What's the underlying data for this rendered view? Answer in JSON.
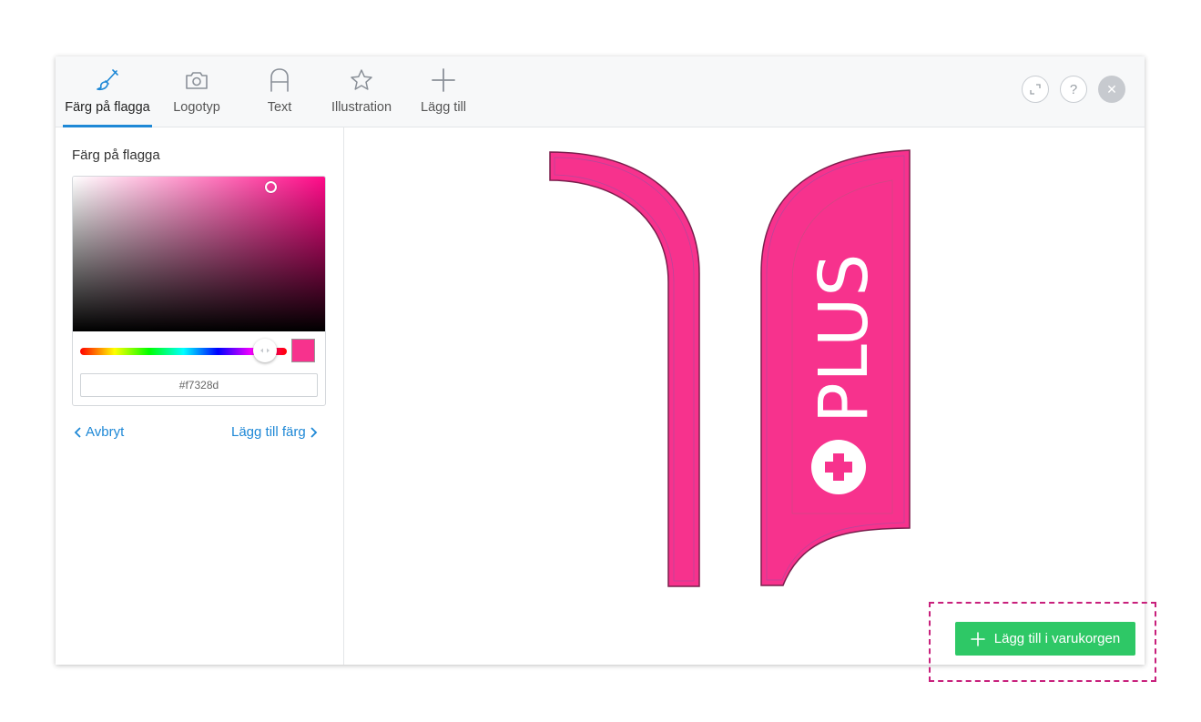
{
  "toolbar": {
    "tabs": [
      {
        "label": "Färg på flagga",
        "icon": "brush-icon",
        "active": true
      },
      {
        "label": "Logotyp",
        "icon": "camera-icon",
        "active": false
      },
      {
        "label": "Text",
        "icon": "letter-a-icon",
        "active": false
      },
      {
        "label": "Illustration",
        "icon": "star-icon",
        "active": false
      },
      {
        "label": "Lägg till",
        "icon": "plus-icon",
        "active": false
      }
    ],
    "tools": {
      "expand_icon": "expand-icon",
      "help_label": "?",
      "close_label": "✕"
    }
  },
  "sidebar": {
    "title": "Färg på flagga",
    "color_picker": {
      "hex_value": "#f7328d",
      "color": "#f7328d"
    },
    "cancel_label": "Avbryt",
    "add_color_label": "Lägg till färg"
  },
  "canvas": {
    "flag_color": "#f7328d",
    "flag_text": "PLUS"
  },
  "cart_button": {
    "label": "Lägg till i varukorgen"
  },
  "colors": {
    "accent": "#1e88d6",
    "cart_green": "#2ec866",
    "highlight": "#c8207c"
  }
}
